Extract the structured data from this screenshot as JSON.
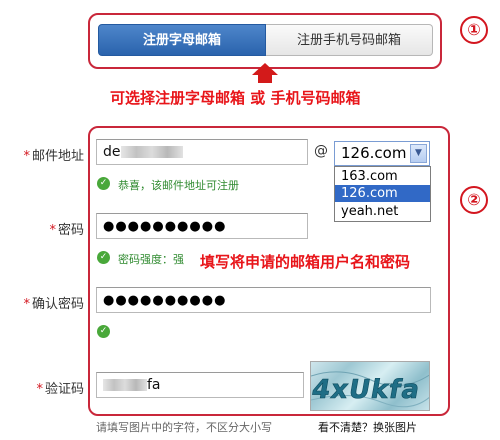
{
  "tabs": [
    {
      "label": "注册字母邮箱",
      "active": true
    },
    {
      "label": "注册手机号码邮箱",
      "active": false
    }
  ],
  "annotations": {
    "marker_1": "①",
    "marker_2": "②",
    "note_tabs": "可选择注册字母邮箱 或 手机号码邮箱",
    "note_form": "填写将申请的邮箱用户名和密码"
  },
  "form": {
    "required_mark": "*",
    "email": {
      "label": "邮件地址",
      "value_prefix": "de",
      "at": "@",
      "domain_selected": "126.com",
      "domain_options": [
        "163.com",
        "126.com",
        "yeah.net"
      ],
      "success": "恭喜，该邮件地址可注册"
    },
    "password": {
      "label": "密码",
      "value": "●●●●●●●●●●",
      "strength": "密码强度：强"
    },
    "confirm": {
      "label": "确认密码",
      "value": "●●●●●●●●●●"
    },
    "captcha": {
      "label": "验证码",
      "value_suffix": "fa",
      "image_text": "4xUkfa",
      "hint": "请填写图片中的字符，不区分大小写",
      "refresh_link": "看不清楚？换张图片"
    }
  },
  "colors": {
    "accent_red": "#d3161f",
    "tab_active": "#2a63ad",
    "success_green": "#49a83a",
    "dropdown_selected": "#3169c6"
  }
}
